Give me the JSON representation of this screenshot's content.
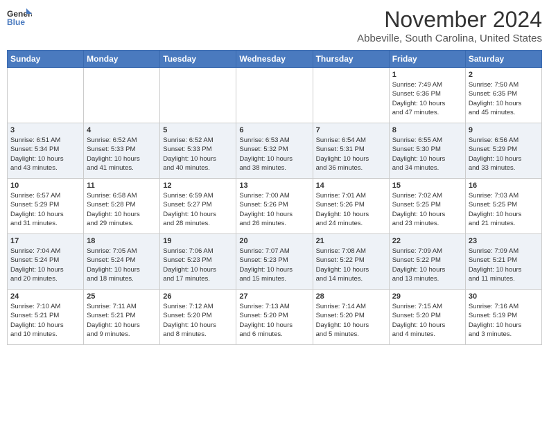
{
  "header": {
    "logo_line1": "General",
    "logo_line2": "Blue",
    "month_title": "November 2024",
    "location": "Abbeville, South Carolina, United States"
  },
  "weekdays": [
    "Sunday",
    "Monday",
    "Tuesday",
    "Wednesday",
    "Thursday",
    "Friday",
    "Saturday"
  ],
  "weeks": [
    [
      {
        "day": "",
        "info": ""
      },
      {
        "day": "",
        "info": ""
      },
      {
        "day": "",
        "info": ""
      },
      {
        "day": "",
        "info": ""
      },
      {
        "day": "",
        "info": ""
      },
      {
        "day": "1",
        "info": "Sunrise: 7:49 AM\nSunset: 6:36 PM\nDaylight: 10 hours\nand 47 minutes."
      },
      {
        "day": "2",
        "info": "Sunrise: 7:50 AM\nSunset: 6:35 PM\nDaylight: 10 hours\nand 45 minutes."
      }
    ],
    [
      {
        "day": "3",
        "info": "Sunrise: 6:51 AM\nSunset: 5:34 PM\nDaylight: 10 hours\nand 43 minutes."
      },
      {
        "day": "4",
        "info": "Sunrise: 6:52 AM\nSunset: 5:33 PM\nDaylight: 10 hours\nand 41 minutes."
      },
      {
        "day": "5",
        "info": "Sunrise: 6:52 AM\nSunset: 5:33 PM\nDaylight: 10 hours\nand 40 minutes."
      },
      {
        "day": "6",
        "info": "Sunrise: 6:53 AM\nSunset: 5:32 PM\nDaylight: 10 hours\nand 38 minutes."
      },
      {
        "day": "7",
        "info": "Sunrise: 6:54 AM\nSunset: 5:31 PM\nDaylight: 10 hours\nand 36 minutes."
      },
      {
        "day": "8",
        "info": "Sunrise: 6:55 AM\nSunset: 5:30 PM\nDaylight: 10 hours\nand 34 minutes."
      },
      {
        "day": "9",
        "info": "Sunrise: 6:56 AM\nSunset: 5:29 PM\nDaylight: 10 hours\nand 33 minutes."
      }
    ],
    [
      {
        "day": "10",
        "info": "Sunrise: 6:57 AM\nSunset: 5:29 PM\nDaylight: 10 hours\nand 31 minutes."
      },
      {
        "day": "11",
        "info": "Sunrise: 6:58 AM\nSunset: 5:28 PM\nDaylight: 10 hours\nand 29 minutes."
      },
      {
        "day": "12",
        "info": "Sunrise: 6:59 AM\nSunset: 5:27 PM\nDaylight: 10 hours\nand 28 minutes."
      },
      {
        "day": "13",
        "info": "Sunrise: 7:00 AM\nSunset: 5:26 PM\nDaylight: 10 hours\nand 26 minutes."
      },
      {
        "day": "14",
        "info": "Sunrise: 7:01 AM\nSunset: 5:26 PM\nDaylight: 10 hours\nand 24 minutes."
      },
      {
        "day": "15",
        "info": "Sunrise: 7:02 AM\nSunset: 5:25 PM\nDaylight: 10 hours\nand 23 minutes."
      },
      {
        "day": "16",
        "info": "Sunrise: 7:03 AM\nSunset: 5:25 PM\nDaylight: 10 hours\nand 21 minutes."
      }
    ],
    [
      {
        "day": "17",
        "info": "Sunrise: 7:04 AM\nSunset: 5:24 PM\nDaylight: 10 hours\nand 20 minutes."
      },
      {
        "day": "18",
        "info": "Sunrise: 7:05 AM\nSunset: 5:24 PM\nDaylight: 10 hours\nand 18 minutes."
      },
      {
        "day": "19",
        "info": "Sunrise: 7:06 AM\nSunset: 5:23 PM\nDaylight: 10 hours\nand 17 minutes."
      },
      {
        "day": "20",
        "info": "Sunrise: 7:07 AM\nSunset: 5:23 PM\nDaylight: 10 hours\nand 15 minutes."
      },
      {
        "day": "21",
        "info": "Sunrise: 7:08 AM\nSunset: 5:22 PM\nDaylight: 10 hours\nand 14 minutes."
      },
      {
        "day": "22",
        "info": "Sunrise: 7:09 AM\nSunset: 5:22 PM\nDaylight: 10 hours\nand 13 minutes."
      },
      {
        "day": "23",
        "info": "Sunrise: 7:09 AM\nSunset: 5:21 PM\nDaylight: 10 hours\nand 11 minutes."
      }
    ],
    [
      {
        "day": "24",
        "info": "Sunrise: 7:10 AM\nSunset: 5:21 PM\nDaylight: 10 hours\nand 10 minutes."
      },
      {
        "day": "25",
        "info": "Sunrise: 7:11 AM\nSunset: 5:21 PM\nDaylight: 10 hours\nand 9 minutes."
      },
      {
        "day": "26",
        "info": "Sunrise: 7:12 AM\nSunset: 5:20 PM\nDaylight: 10 hours\nand 8 minutes."
      },
      {
        "day": "27",
        "info": "Sunrise: 7:13 AM\nSunset: 5:20 PM\nDaylight: 10 hours\nand 6 minutes."
      },
      {
        "day": "28",
        "info": "Sunrise: 7:14 AM\nSunset: 5:20 PM\nDaylight: 10 hours\nand 5 minutes."
      },
      {
        "day": "29",
        "info": "Sunrise: 7:15 AM\nSunset: 5:20 PM\nDaylight: 10 hours\nand 4 minutes."
      },
      {
        "day": "30",
        "info": "Sunrise: 7:16 AM\nSunset: 5:19 PM\nDaylight: 10 hours\nand 3 minutes."
      }
    ]
  ]
}
